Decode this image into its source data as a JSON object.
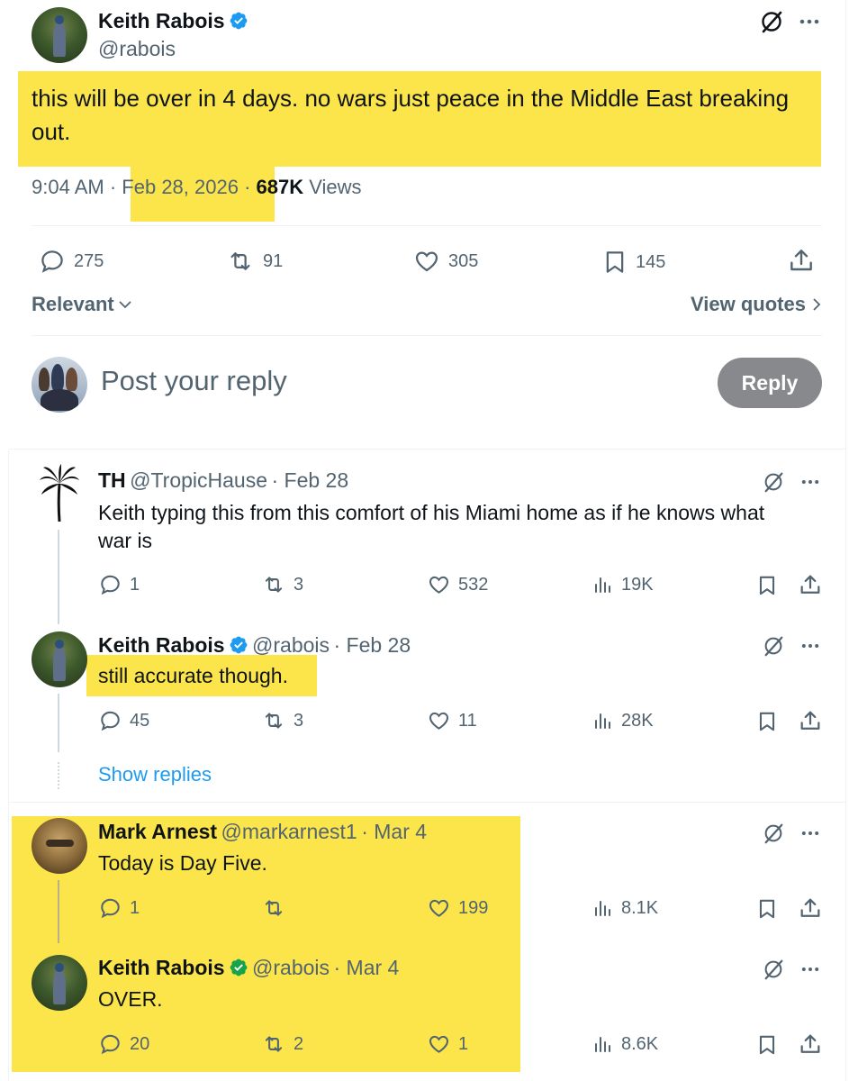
{
  "main_tweet": {
    "author_name": "Keith Rabois",
    "handle": "@rabois",
    "text_line1": "this will be over in 4 days.  no wars just peace in the Middle East breaking",
    "text_line2": "out.",
    "time": "9:04 AM",
    "sep1": "·",
    "date": "Feb 28, 2026",
    "sep2": "·",
    "views_count": "687K",
    "views_label": "Views",
    "replies": "275",
    "retweets": "91",
    "likes": "305",
    "bookmarks": "145"
  },
  "sort": {
    "relevant_label": "Relevant",
    "view_quotes_label": "View quotes"
  },
  "composer": {
    "placeholder": "Post your reply",
    "reply_button": "Reply"
  },
  "replies": [
    {
      "author_name": "TH",
      "handle": "@TropicHause",
      "date": "· Feb 28",
      "text_line1": "Keith typing this from this comfort of his Miami home as if he knows what",
      "text_line2": "war is",
      "replies": "1",
      "retweets": "3",
      "likes": "532",
      "views": "19K"
    },
    {
      "author_name": "Keith Rabois",
      "handle": "@rabois",
      "date": "· Feb 28",
      "text_line1": "still accurate though.",
      "replies": "45",
      "retweets": "3",
      "likes": "11",
      "views": "28K"
    },
    {
      "author_name": "Mark Arnest",
      "handle": "@markarnest1",
      "date": "· Mar 4",
      "text_line1": "Today is Day Five.",
      "replies": "1",
      "retweets": "",
      "likes": "199",
      "views": "8.1K"
    },
    {
      "author_name": "Keith Rabois",
      "handle": "@rabois",
      "date": "· Mar 4",
      "text_line1": "OVER.",
      "replies": "20",
      "retweets": "2",
      "likes": "1",
      "views": "8.6K"
    }
  ],
  "show_replies_label": "Show replies",
  "colors": {
    "highlight": "#fbe54a",
    "verified_blue": "#1d9bf0",
    "verified_green": "#17a34a",
    "link_blue": "#1d9bf0",
    "muted": "#536471",
    "reply_button_bg": "#87898c"
  }
}
